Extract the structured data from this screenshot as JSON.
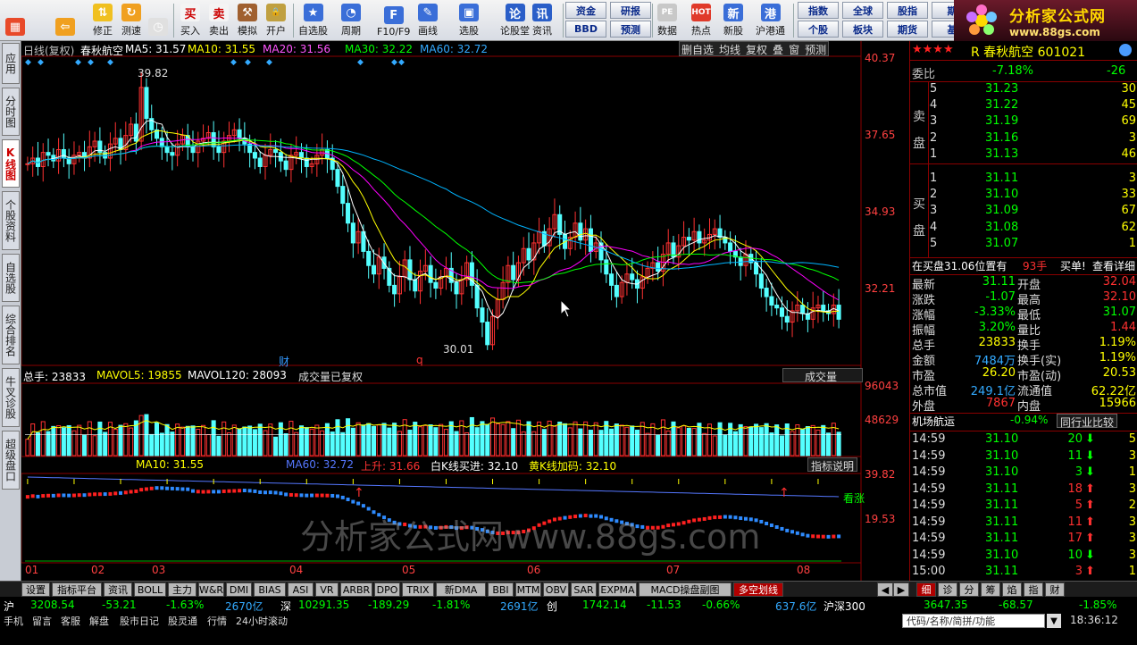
{
  "toolbar": {
    "buttons": [
      {
        "label": "",
        "icon": "windows-icon"
      },
      {
        "label": "",
        "icon": "back-arrow-icon"
      },
      {
        "label": "修正",
        "icon": "up-down-arrows-icon"
      },
      {
        "label": "测速",
        "icon": "refresh-icon"
      },
      {
        "label": "",
        "icon": "clock-icon"
      },
      {
        "label": "买入",
        "icon": "buy-icon"
      },
      {
        "label": "卖出",
        "icon": "sell-icon"
      },
      {
        "label": "模拟",
        "icon": "hammer-icon"
      },
      {
        "label": "开户",
        "icon": "lock-icon"
      },
      {
        "label": "自选股",
        "icon": "star-folder-icon"
      },
      {
        "label": "周期",
        "icon": "period-clock-icon"
      },
      {
        "label": "F10/F9",
        "icon": "f10-icon"
      },
      {
        "label": "画线",
        "icon": "pen-icon"
      },
      {
        "label": "选股",
        "icon": "screen-icon"
      },
      {
        "label": "论股堂",
        "icon": "discuss-icon"
      },
      {
        "label": "资讯",
        "icon": "news-icon"
      },
      {
        "label": "数据",
        "icon": "data-pe-icon"
      },
      {
        "label": "热点",
        "icon": "hot-icon"
      },
      {
        "label": "新股",
        "icon": "new-stock-icon"
      },
      {
        "label": "沪港通",
        "icon": "hk-connect-icon"
      }
    ],
    "small_buttons": [
      "资金",
      "研报",
      "BBD",
      "预测",
      "指数",
      "全球",
      "股指",
      "期",
      "个股",
      "板块",
      "期货",
      "基"
    ]
  },
  "logo": {
    "title": "分析家公式网",
    "url": "www.88gs.com"
  },
  "left_tabs": [
    "应用",
    "分时图",
    "K线图",
    "个股资料",
    "自选股",
    "综合排名",
    "牛叉诊股",
    "超级盘口"
  ],
  "chart": {
    "header": {
      "period": "日线(复权)",
      "name": "春秋航空",
      "ma5": "MA5: 31.57",
      "ma10": "MA10: 31.55",
      "ma20": "MA20: 31.56",
      "ma30": "MA30: 32.22",
      "ma60": "MA60: 32.72"
    },
    "top_buttons": [
      "删自选",
      "均线",
      "复权",
      "叠",
      "窗",
      "预测"
    ],
    "price_axis": [
      "40.37",
      "37.65",
      "34.93",
      "32.21"
    ],
    "high_label": "39.82",
    "low_label": "30.01",
    "cai_label": "财",
    "q_label": "q",
    "vol_header": {
      "total": "总手: 23833",
      "mavol5": "MAVOL5: 19855",
      "mavol120": "MAVOL120: 28093",
      "note": "成交量已复权",
      "dropdown": "成交量"
    },
    "vol_axis": [
      "96043",
      "48629"
    ],
    "ind_header": {
      "ma10": "MA10: 31.55",
      "ma60": "MA60: 32.72",
      "up": "上升: 31.66",
      "white": "白K线买进: 32.10",
      "yellow": "黄K线加码: 32.10",
      "explain": "指标说明"
    },
    "ind_axis": [
      "39.82",
      "19.53"
    ],
    "ind_label": "看涨",
    "watermark": "分析家公式网www.88gs.com",
    "months": [
      "01",
      "02",
      "03",
      "04",
      "05",
      "06",
      "07",
      "08"
    ]
  },
  "chart_data": {
    "type": "candlestick",
    "title": "春秋航空 日线(复权)",
    "ylim": [
      29.5,
      40.37
    ],
    "price_axis_ticks": [
      40.37,
      37.65,
      34.93,
      32.21
    ],
    "high": 39.82,
    "low": 30.01,
    "close_series": [
      36.6,
      36.8,
      36.5,
      37.0,
      36.9,
      36.7,
      37.1,
      36.8,
      36.6,
      36.9,
      37.0,
      36.8,
      37.2,
      37.4,
      37.0,
      36.8,
      37.3,
      37.5,
      37.1,
      37.6,
      38.0,
      37.4,
      39.3,
      38.2,
      37.8,
      37.5,
      37.2,
      37.0,
      36.9,
      37.3,
      37.6,
      37.2,
      37.0,
      37.4,
      37.5,
      37.7,
      37.2,
      37.0,
      37.4,
      37.6,
      37.8,
      37.5,
      37.3,
      37.0,
      36.8,
      36.5,
      36.9,
      37.1,
      37.0,
      36.7,
      36.4,
      36.9,
      37.0,
      36.8,
      36.5,
      36.6,
      36.9,
      37.1,
      36.8,
      36.4,
      35.8,
      35.2,
      34.5,
      33.8,
      34.2,
      33.5,
      33.0,
      32.7,
      33.3,
      32.9,
      32.3,
      32.0,
      32.6,
      33.2,
      32.5,
      32.1,
      32.8,
      33.0,
      32.4,
      32.2,
      32.6,
      32.9,
      32.4,
      32.0,
      32.5,
      33.1,
      32.3,
      31.5,
      31.0,
      30.2,
      31.2,
      31.8,
      32.4,
      33.0,
      32.5,
      33.1,
      33.6,
      33.2,
      33.8,
      34.2,
      33.7,
      34.3,
      34.8,
      34.1,
      33.6,
      34.0,
      34.5,
      33.9,
      34.3,
      33.5,
      33.8,
      33.2,
      32.7,
      32.3,
      31.9,
      32.4,
      32.7,
      32.5,
      32.2,
      32.6,
      32.9,
      33.1,
      32.8,
      33.4,
      33.8,
      33.3,
      33.7,
      34.0,
      33.9,
      34.2,
      33.8,
      33.9,
      34.1,
      34.3,
      34.0,
      33.8,
      33.5,
      33.3,
      33.0,
      33.4,
      33.1,
      32.7,
      32.2,
      31.9,
      31.6,
      31.5,
      31.2,
      31.0,
      31.4,
      31.6,
      31.3,
      31.1,
      31.5,
      31.6,
      31.4,
      31.3,
      31.6,
      31.1
    ],
    "ma_series": [
      {
        "name": "MA5",
        "value": 31.57,
        "color": "#ffffff"
      },
      {
        "name": "MA10",
        "value": 31.55,
        "color": "#ffff00"
      },
      {
        "name": "MA20",
        "value": 31.56,
        "color": "#ff00ff"
      },
      {
        "name": "MA30",
        "value": 32.22,
        "color": "#00ff00"
      },
      {
        "name": "MA60",
        "value": 32.72,
        "color": "#00b4ff"
      }
    ],
    "volume": {
      "ylim": [
        0,
        96043
      ],
      "ticks": [
        96043,
        48629
      ],
      "total": 23833,
      "mavol5": 19855,
      "mavol120": 28093
    },
    "x_months": [
      "01",
      "02",
      "03",
      "04",
      "05",
      "06",
      "07",
      "08"
    ]
  },
  "right": {
    "title": "R 春秋航空  601021",
    "weibi": {
      "label": "委比",
      "pct": "-7.18%",
      "val": "-26"
    },
    "sell_label": "卖盘",
    "buy_label": "买盘",
    "asks": [
      {
        "n": "5",
        "p": "31.23",
        "v": "30"
      },
      {
        "n": "4",
        "p": "31.22",
        "v": "45"
      },
      {
        "n": "3",
        "p": "31.19",
        "v": "69"
      },
      {
        "n": "2",
        "p": "31.16",
        "v": "3"
      },
      {
        "n": "1",
        "p": "31.13",
        "v": "46"
      }
    ],
    "bids": [
      {
        "n": "1",
        "p": "31.11",
        "v": "3"
      },
      {
        "n": "2",
        "p": "31.10",
        "v": "33"
      },
      {
        "n": "3",
        "p": "31.09",
        "v": "67"
      },
      {
        "n": "4",
        "p": "31.08",
        "v": "62"
      },
      {
        "n": "5",
        "p": "31.07",
        "v": "1"
      }
    ],
    "position": {
      "text": "在买盘31.06位置有",
      "qty": "93手",
      "buy": "买单!",
      "detail": "查看详细"
    },
    "stats": [
      {
        "l": "最新",
        "v": "31.11",
        "l2": "开盘",
        "v2": "32.04"
      },
      {
        "l": "涨跌",
        "v": "-1.07",
        "l2": "最高",
        "v2": "32.10"
      },
      {
        "l": "涨幅",
        "v": "-3.33%",
        "l2": "最低",
        "v2": "31.07"
      },
      {
        "l": "振幅",
        "v": "3.20%",
        "l2": "量比",
        "v2": "1.44"
      },
      {
        "l": "总手",
        "v": "23833",
        "l2": "换手",
        "v2": "1.19%"
      },
      {
        "l": "金额",
        "v": "7484万",
        "l2": "换手(实)",
        "v2": "1.19%"
      },
      {
        "l": "市盈",
        "v": "26.20",
        "l2": "市盈(动)",
        "v2": "20.53"
      },
      {
        "l": "总市值",
        "v": "249.1亿",
        "l2": "流通值",
        "v2": "62.22亿"
      },
      {
        "l": "外盘",
        "v": "7867",
        "l2": "内盘",
        "v2": "15966"
      }
    ],
    "sector": {
      "name": "机场航运",
      "pct": "-0.94%",
      "compare": "同行业比较"
    },
    "ticks": [
      {
        "t": "14:59",
        "p": "31.10",
        "v": "20",
        "d": "down",
        "n": "5"
      },
      {
        "t": "14:59",
        "p": "31.10",
        "v": "11",
        "d": "down",
        "n": "3"
      },
      {
        "t": "14:59",
        "p": "31.10",
        "v": "3",
        "d": "down",
        "n": "1"
      },
      {
        "t": "14:59",
        "p": "31.11",
        "v": "18",
        "d": "up",
        "n": "3"
      },
      {
        "t": "14:59",
        "p": "31.11",
        "v": "5",
        "d": "up",
        "n": "2"
      },
      {
        "t": "14:59",
        "p": "31.11",
        "v": "11",
        "d": "up",
        "n": "3"
      },
      {
        "t": "14:59",
        "p": "31.11",
        "v": "17",
        "d": "up",
        "n": "3"
      },
      {
        "t": "14:59",
        "p": "31.10",
        "v": "10",
        "d": "down",
        "n": "3"
      },
      {
        "t": "15:00",
        "p": "31.11",
        "v": "3",
        "d": "up",
        "n": "1"
      }
    ],
    "tabs": [
      "细",
      "诊",
      "分",
      "筹",
      "焰",
      "指",
      "财"
    ]
  },
  "bottom_tabs": [
    "设置",
    "指标平台",
    "资讯",
    "BOLL",
    "主力",
    "W&R",
    "DMI",
    "BIAS",
    "ASI",
    "VR",
    "ARBR",
    "DPO",
    "TRIX",
    "新DMA",
    "BBI",
    "MTM",
    "OBV",
    "SAR",
    "EXPMA",
    "MACD操盘副图",
    "多空划线"
  ],
  "ticker": {
    "sh_label": "沪",
    "sh_idx": "3208.54",
    "sh_chg": "-53.21",
    "sh_pct": "-1.63%",
    "sh_amt": "2670亿",
    "sz_label": "深",
    "sz_idx": "10291.35",
    "sz_chg": "-189.29",
    "sz_pct": "-1.81%",
    "sz_amt": "2691亿",
    "cy_label": "创",
    "cy_idx": "1742.14",
    "cy_chg": "-11.53",
    "cy_pct": "-0.66%",
    "cy_amt": "637.6亿",
    "hs_label": "沪深300",
    "hs_idx": "3647.35",
    "hs_chg": "-68.57",
    "hs_pct": "-1.85%"
  },
  "status": {
    "items": [
      "手机",
      "留言",
      "客服",
      "解盘",
      "股市日记",
      "股灵通",
      "行情",
      "24小时滚动"
    ],
    "search_placeholder": "代码/名称/简拼/功能",
    "clock": "18:36:12"
  }
}
